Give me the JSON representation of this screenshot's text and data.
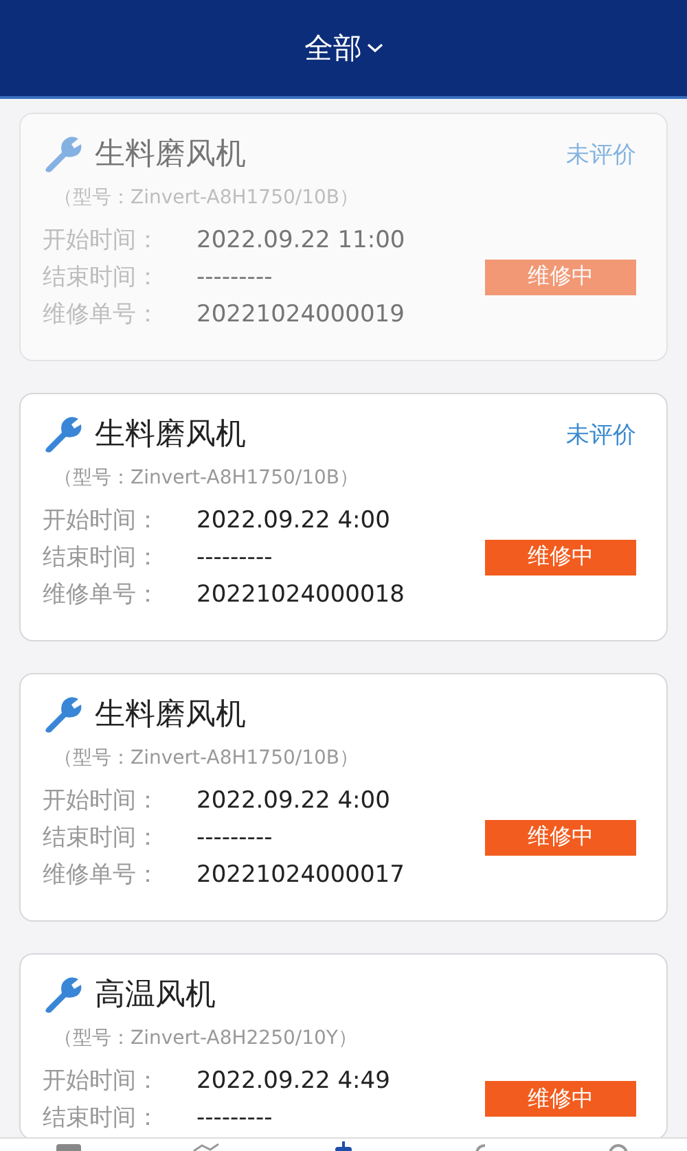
{
  "header": {
    "title": "全部"
  },
  "cards": [
    {
      "title": "生料磨风机",
      "model": "（型号：Zinvert-A8H1750/10B）",
      "rating": "未评价",
      "status": "维修中",
      "dimmed": true,
      "fields": [
        {
          "label": "开始时间：",
          "value": "2022.09.22 11:00"
        },
        {
          "label": "结束时间：",
          "value": "---------"
        },
        {
          "label": "维修单号：",
          "value": "20221024000019"
        }
      ]
    },
    {
      "title": "生料磨风机",
      "model": "（型号：Zinvert-A8H1750/10B）",
      "rating": "未评价",
      "status": "维修中",
      "dimmed": false,
      "fields": [
        {
          "label": "开始时间：",
          "value": "2022.09.22 4:00"
        },
        {
          "label": "结束时间：",
          "value": "---------"
        },
        {
          "label": "维修单号：",
          "value": "20221024000018"
        }
      ]
    },
    {
      "title": "生料磨风机",
      "model": "（型号：Zinvert-A8H1750/10B）",
      "status": "维修中",
      "dimmed": false,
      "fields": [
        {
          "label": "开始时间：",
          "value": "2022.09.22 4:00"
        },
        {
          "label": "结束时间：",
          "value": "---------"
        },
        {
          "label": "维修单号：",
          "value": "20221024000017"
        }
      ]
    },
    {
      "title": "高温风机",
      "model": "（型号：Zinvert-A8H2250/10Y）",
      "status": "维修中",
      "dimmed": false,
      "fields": [
        {
          "label": "开始时间：",
          "value": "2022.09.22 4:49"
        },
        {
          "label": "结束时间：",
          "value": "---------"
        }
      ]
    }
  ]
}
